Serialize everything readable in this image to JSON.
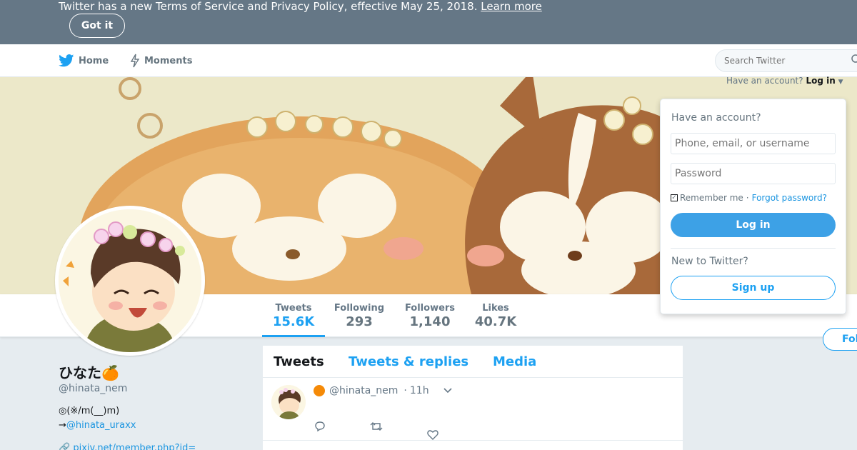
{
  "notice": {
    "text": "Twitter has a new Terms of Service and Privacy Policy, effective May 25, 2018.",
    "link": "Learn more",
    "button": "Got it"
  },
  "nav": {
    "home": "Home",
    "moments": "Moments",
    "search_placeholder": "Search Twitter"
  },
  "login": {
    "prompt": "Have an account?",
    "prompt_link": "Log in",
    "title": "Have an account?",
    "username_placeholder": "Phone, email, or username",
    "password_placeholder": "Password",
    "remember": "Remember me",
    "separator": "·",
    "forgot": "Forgot password?",
    "login_button": "Log in",
    "new_prompt": "New to Twitter?",
    "signup_button": "Sign up"
  },
  "stats": [
    {
      "label": "Tweets",
      "value": "15.6K"
    },
    {
      "label": "Following",
      "value": "293"
    },
    {
      "label": "Followers",
      "value": "1,140"
    },
    {
      "label": "Likes",
      "value": "40.7K"
    }
  ],
  "follow_button": "Follow",
  "profile": {
    "display_name": "ひなた🍊",
    "handle": "@hinata_nem",
    "bio_line1": "◎(※/m(__)m)",
    "bio_arrow": "→",
    "bio_link": "@hinata_uraxx",
    "website": "pixiv.net/member.php?id="
  },
  "timeline": {
    "tabs": [
      "Tweets",
      "Tweets & replies",
      "Media"
    ],
    "tweet": {
      "handle": "@hinata_nem",
      "dot": "·",
      "time": "11h"
    }
  },
  "colors": {
    "banner_bg": "#657786",
    "accent": "#1da1f2",
    "login_button": "#3da1e6"
  }
}
